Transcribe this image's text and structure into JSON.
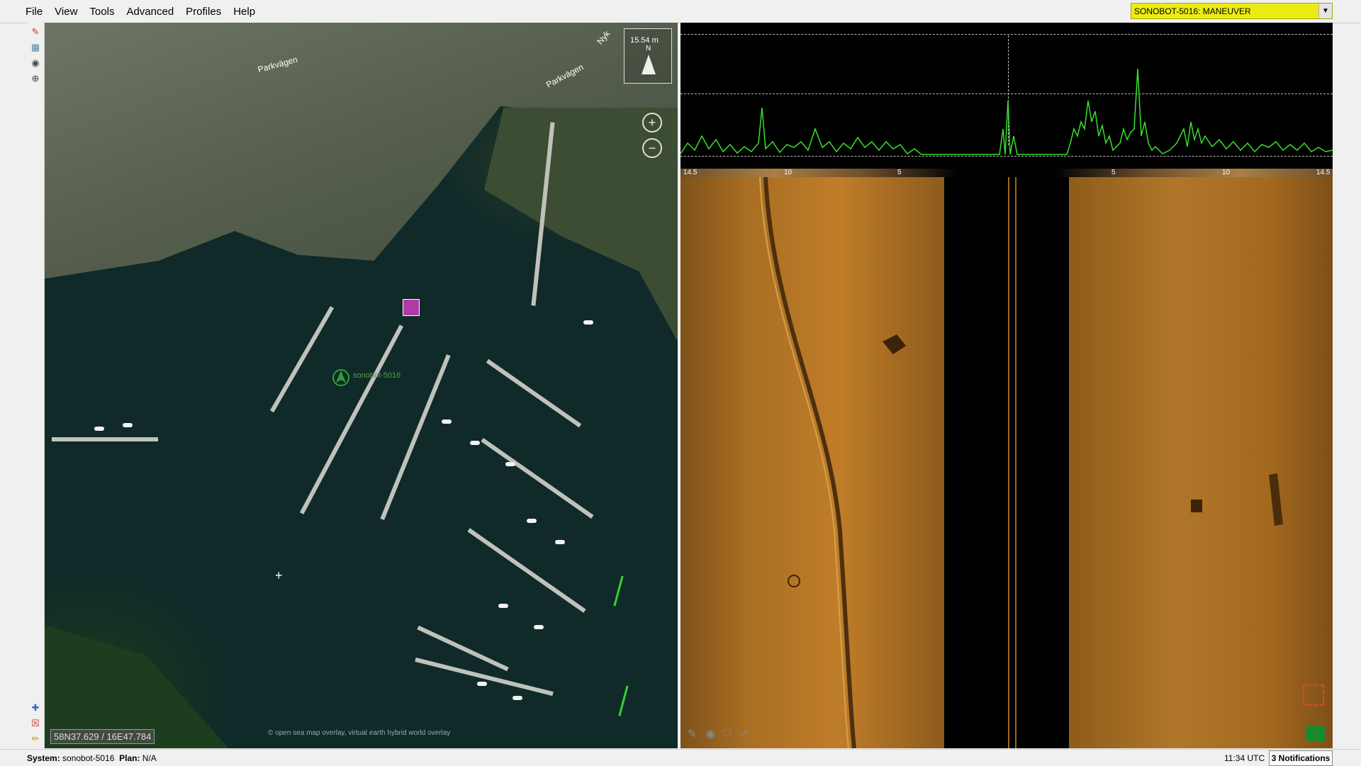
{
  "menu": [
    "File",
    "View",
    "Tools",
    "Advanced",
    "Profiles",
    "Help"
  ],
  "mode_select": {
    "value": "SONOBOT-5016: MANEUVER",
    "color": "#ecec14"
  },
  "map": {
    "scale_label": "15.54 m",
    "north_label": "N",
    "coordinates": "58N37.629 / 16E47.784",
    "attribution": "© open sea map overlay, virtual earth hybrid world overlay",
    "vehicle_label": "sonobot-5016",
    "street_labels": [
      "Parkvägen",
      "Parkvägen",
      "Nyk"
    ]
  },
  "sonar": {
    "ruler_ticks": [
      "14.5",
      "10",
      "5",
      "5",
      "10",
      "14.5"
    ]
  },
  "status": {
    "system_label": "System:",
    "system_value": "sonobot-5016",
    "plan_label": "Plan:",
    "plan_value": "N/A",
    "time": "11:34 UTC",
    "notifications": "3 Notifications"
  },
  "icons": [
    "pencil-icon",
    "map-layer-icon",
    "eye-icon",
    "target-icon",
    "waypoint-add-icon",
    "delete-icon",
    "edit-icon"
  ]
}
